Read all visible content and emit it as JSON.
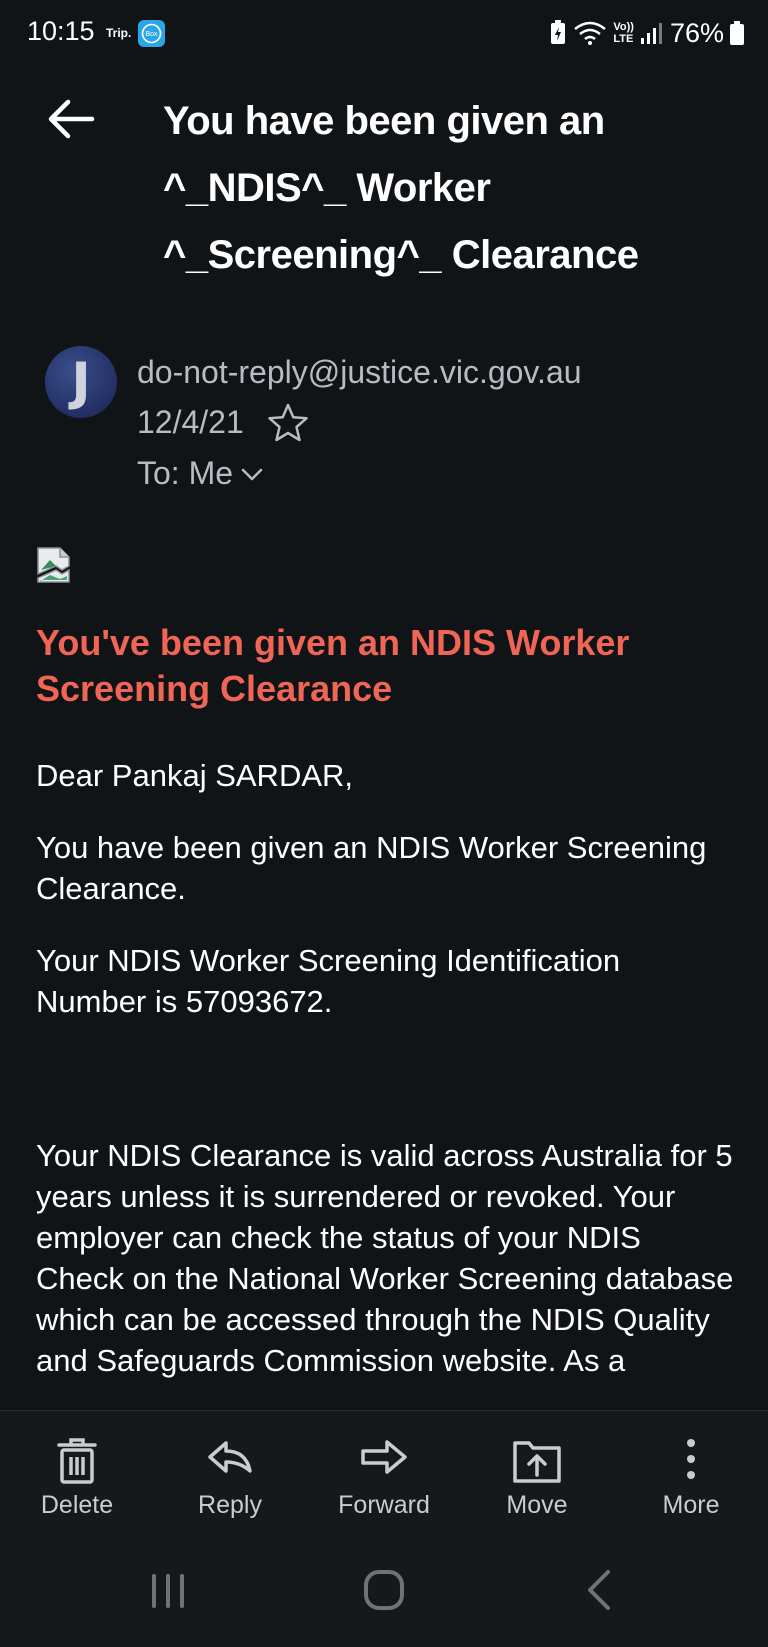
{
  "status_bar": {
    "time": "10:15",
    "trip_label": "Trip.",
    "box_icon_label": "Box",
    "network_label_top": "Vo))",
    "network_label_bottom": "LTE",
    "battery": "76%"
  },
  "header": {
    "subject": "You have been given an ^_NDIS^_ Worker ^_Screening^_ Clearance"
  },
  "sender": {
    "avatar_letter": "J",
    "email": "do-not-reply@justice.vic.gov.au",
    "date": "12/4/21",
    "recipient": "To: Me"
  },
  "body": {
    "heading": "You've been given an NDIS Worker Screening Clearance",
    "greeting": "Dear Pankaj SARDAR,",
    "paragraph1": "You have been given an NDIS Worker Screening Clearance.",
    "paragraph2": "Your NDIS Worker Screening Identification Number is 57093672.",
    "paragraph3": "Your NDIS Clearance is valid across Australia for 5 years unless it is surrendered or revoked. Your employer can check the status of your NDIS Check on the National Worker Screening database which can be accessed through the NDIS Quality and Safeguards Commission website. As a"
  },
  "toolbar": {
    "delete": "Delete",
    "reply": "Reply",
    "forward": "Forward",
    "move": "Move",
    "more": "More"
  },
  "colors": {
    "background": "#111417",
    "heading_accent": "#f16557",
    "secondary_text": "#b8bcc2",
    "toolbar_bg": "#16191c"
  }
}
